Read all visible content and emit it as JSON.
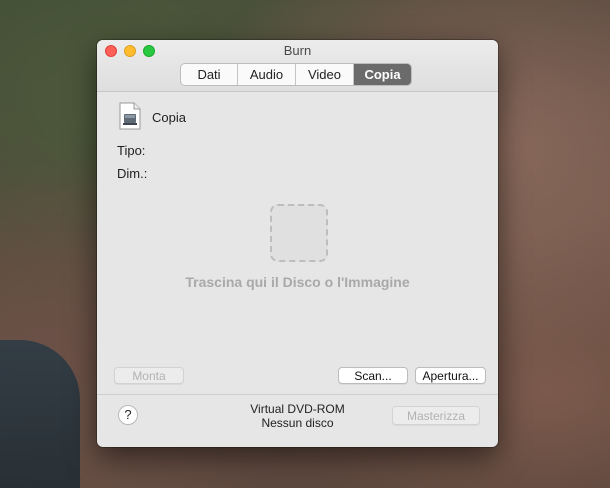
{
  "window": {
    "title": "Burn"
  },
  "tabs": [
    {
      "label": "Dati"
    },
    {
      "label": "Audio"
    },
    {
      "label": "Video"
    },
    {
      "label": "Copia",
      "active": true
    }
  ],
  "content": {
    "name": "Copia",
    "tipo_label": "Tipo:",
    "dim_label": "Dim.:",
    "drop_hint": "Trascina qui il Disco o l'Immagine"
  },
  "buttons": {
    "monta": "Monta",
    "scan": "Scan...",
    "apertura": "Apertura...",
    "masterizza": "Masterizza",
    "help": "?"
  },
  "device": {
    "name": "Virtual DVD-ROM",
    "status": "Nessun disco"
  },
  "colors": {
    "active_tab": "#6b6b6b",
    "close": "#fe5f57",
    "minimize": "#febc2e",
    "zoom": "#28c840"
  }
}
